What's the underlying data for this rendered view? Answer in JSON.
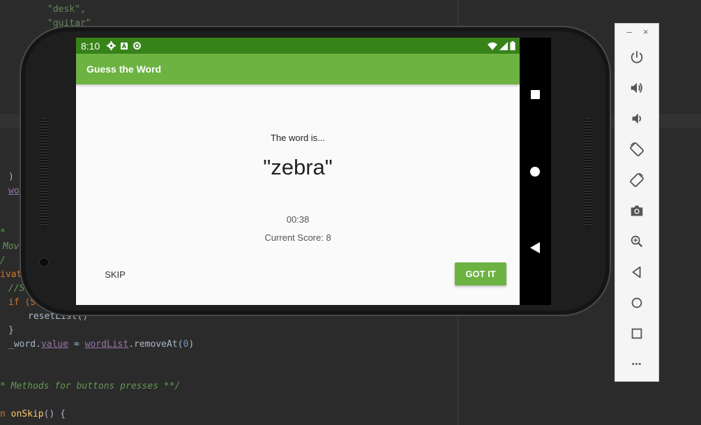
{
  "ide": {
    "lines": [
      {
        "id": "l1",
        "text": "\"desk\","
      },
      {
        "id": "l2",
        "text": "\"guitar\""
      },
      {
        "id": "l3",
        "text": ")"
      },
      {
        "id": "l4",
        "text": "wor"
      },
      {
        "id": "l5",
        "text": "*"
      },
      {
        "id": "l6",
        "text": "Mov"
      },
      {
        "id": "l7",
        "text": "/"
      },
      {
        "id": "l8",
        "text": "ivat"
      },
      {
        "id": "l9",
        "text": "//S"
      },
      {
        "id": "l10",
        "text": "if (S"
      },
      {
        "id": "l11",
        "text": "resetList()"
      },
      {
        "id": "l12",
        "text": "}"
      },
      {
        "id": "l13a",
        "text": "_word."
      },
      {
        "id": "l13b",
        "text": "value"
      },
      {
        "id": "l13c",
        "text": " = "
      },
      {
        "id": "l13d",
        "text": "wordList"
      },
      {
        "id": "l13e",
        "text": ".removeAt("
      },
      {
        "id": "l13f",
        "text": "0"
      },
      {
        "id": "l13g",
        "text": ")"
      },
      {
        "id": "l14",
        "text": "* Methods for buttons presses **/"
      },
      {
        "id": "l15a",
        "text": "n "
      },
      {
        "id": "l15b",
        "text": "onSkip"
      },
      {
        "id": "l15c",
        "text": "() {"
      }
    ]
  },
  "status_bar": {
    "time": "8:10"
  },
  "app": {
    "title": "Guess the Word",
    "word_intro": "The word is...",
    "word": "\"zebra\"",
    "timer": "00:38",
    "score": "Current Score: 8",
    "skip_label": "SKIP",
    "gotit_label": "GOT IT"
  },
  "emulator": {
    "minimize": "–",
    "close": "×",
    "more": "•••"
  },
  "colors": {
    "status_bar": "#38821a",
    "app_bar": "#6cb342",
    "accent": "#6cb342"
  }
}
